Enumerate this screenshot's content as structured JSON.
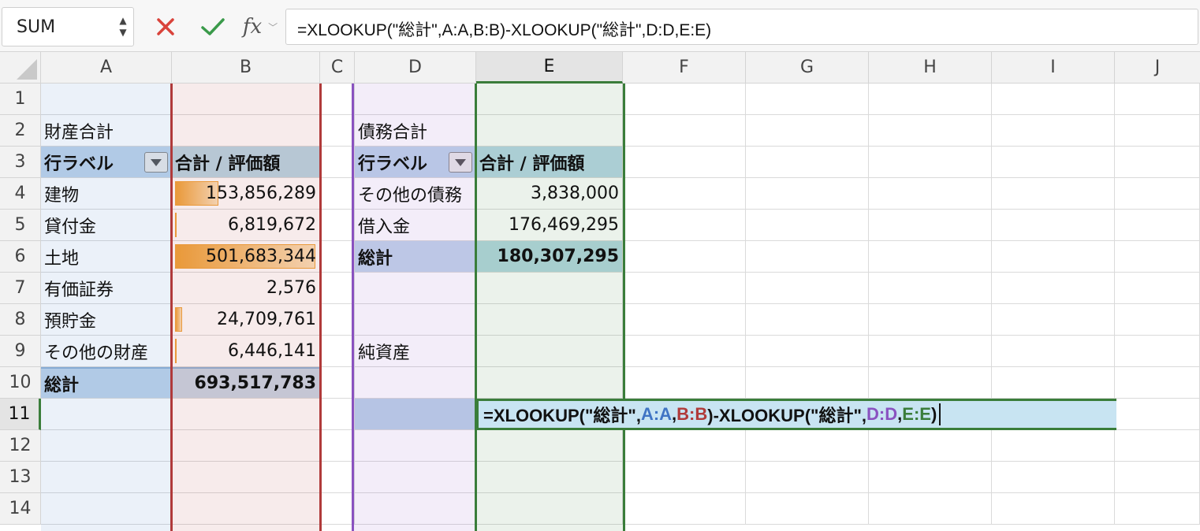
{
  "name_box": {
    "value": "SUM"
  },
  "formula_bar": {
    "fx_label": "fx",
    "formula": "=XLOOKUP(\"総計\",A:A,B:B)-XLOOKUP(\"総計\",D:D,E:E)"
  },
  "columns": [
    "A",
    "B",
    "C",
    "D",
    "E",
    "F",
    "G",
    "H",
    "I",
    "J"
  ],
  "rows": [
    "1",
    "2",
    "3",
    "4",
    "5",
    "6",
    "7",
    "8",
    "9",
    "10",
    "11",
    "12",
    "13",
    "14"
  ],
  "assets_table": {
    "title": "財産合計",
    "header_row_label": "行ラベル",
    "header_value_label": "合計 / 評価額",
    "items": [
      {
        "label": "建物",
        "value": "153,856,289",
        "amount": 153856289
      },
      {
        "label": "貸付金",
        "value": "6,819,672",
        "amount": 6819672
      },
      {
        "label": "土地",
        "value": "501,683,344",
        "amount": 501683344
      },
      {
        "label": "有価証券",
        "value": "2,576",
        "amount": 2576
      },
      {
        "label": "預貯金",
        "value": "24,709,761",
        "amount": 24709761
      },
      {
        "label": "その他の財産",
        "value": "6,446,141",
        "amount": 6446141
      }
    ],
    "total_label": "総計",
    "total_value": "693,517,783"
  },
  "liabilities_table": {
    "title": "債務合計",
    "header_row_label": "行ラベル",
    "header_value_label": "合計 / 評価額",
    "items": [
      {
        "label": "その他の債務",
        "value": "3,838,000"
      },
      {
        "label": "借入金",
        "value": "176,469,295"
      }
    ],
    "total_label": "総計",
    "total_value": "180,307,295"
  },
  "net_assets_label": "純資産",
  "editing_formula": {
    "prefix": "=XLOOKUP(\"総計\",",
    "ref1": "A:A",
    "sep1": ",",
    "ref2": "B:B",
    "mid": ")-XLOOKUP(\"総計\",",
    "ref3": "D:D",
    "sep2": ",",
    "ref4": "E:E",
    "suffix": ")"
  },
  "colors": {
    "ref_a": "#3f74c4",
    "ref_b": "#b03a3a",
    "ref_d": "#8a52c0",
    "ref_e": "#3a7d3a",
    "databar": "#f0a43a",
    "cancel_red": "#d9433b",
    "enter_green": "#3a9a4a"
  }
}
